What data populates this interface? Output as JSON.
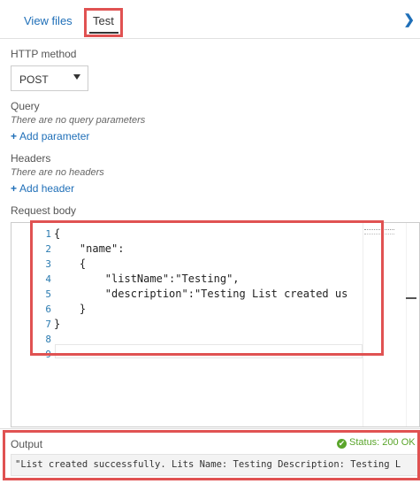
{
  "tabs": [
    {
      "label": "View files",
      "active": false
    },
    {
      "label": "Test",
      "active": true
    }
  ],
  "chevron_icon": "chevron-right-icon",
  "http_method": {
    "label": "HTTP method",
    "selected": "POST"
  },
  "query": {
    "label": "Query",
    "empty_text": "There are no query parameters",
    "add_link": "Add parameter"
  },
  "headers": {
    "label": "Headers",
    "empty_text": "There are no headers",
    "add_link": "Add header"
  },
  "request_body": {
    "label": "Request body",
    "line_numbers": [
      "1",
      "2",
      "3",
      "4",
      "5",
      "6",
      "7",
      "8",
      "9"
    ],
    "lines": [
      "{",
      "    \"name\":",
      "    {",
      "        \"listName\":\"Testing\",",
      "        \"description\":\"Testing List created us",
      "    }",
      "}",
      "",
      ""
    ]
  },
  "output": {
    "label": "Output",
    "status": "Status: 200 OK",
    "text": "\"List created successfully. Lits Name: Testing Description: Testing L"
  },
  "colors": {
    "accent": "#1f6fb8",
    "highlight": "#e05252",
    "success": "#5aa52b"
  }
}
